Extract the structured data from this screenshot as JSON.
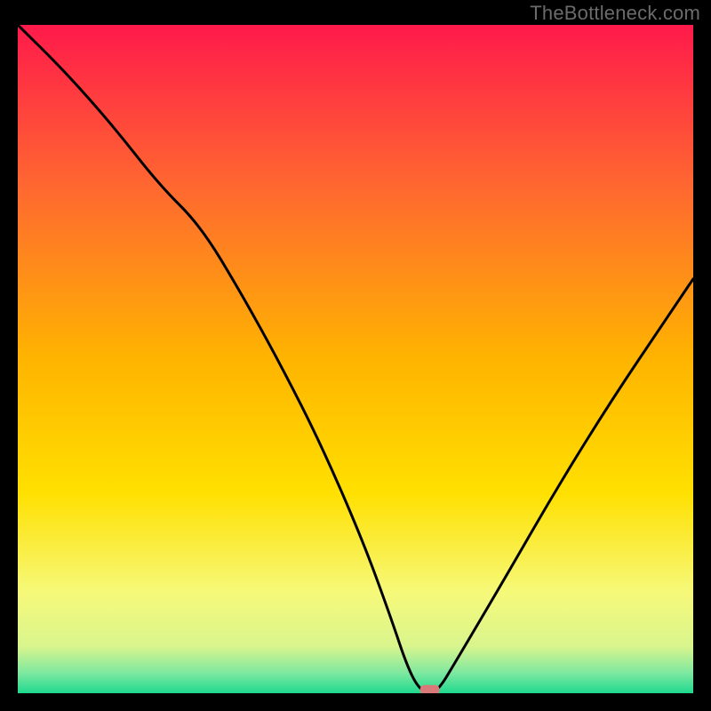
{
  "brand": {
    "watermark": "TheBottleneck.com"
  },
  "chart_data": {
    "type": "line",
    "title": "",
    "xlabel": "",
    "ylabel": "",
    "xlim": [
      0,
      100
    ],
    "ylim": [
      0,
      100
    ],
    "grid": false,
    "legend": false,
    "background_gradient": {
      "stops": [
        {
          "offset": 0.0,
          "color": "#ff1a4b"
        },
        {
          "offset": 0.25,
          "color": "#ff6a2f"
        },
        {
          "offset": 0.5,
          "color": "#ffb400"
        },
        {
          "offset": 0.7,
          "color": "#ffe000"
        },
        {
          "offset": 0.85,
          "color": "#f6f97a"
        },
        {
          "offset": 0.93,
          "color": "#d9f58d"
        },
        {
          "offset": 0.97,
          "color": "#7de8a0"
        },
        {
          "offset": 1.0,
          "color": "#1fd98e"
        }
      ]
    },
    "series": [
      {
        "name": "bottleneck-curve",
        "x": [
          0,
          7,
          14,
          21,
          27,
          33,
          39,
          45,
          51,
          55,
          58,
          60,
          62,
          65,
          72,
          80,
          88,
          96,
          100
        ],
        "y": [
          100,
          93,
          85,
          76,
          70,
          60,
          49,
          37,
          23,
          12,
          3,
          0,
          0,
          5,
          17,
          31,
          44,
          56,
          62
        ]
      }
    ],
    "markers": [
      {
        "name": "optimal-marker",
        "x": 61,
        "y": 0.5,
        "color": "#d97a7a"
      }
    ]
  },
  "colors": {
    "frame_bg": "#000000",
    "curve": "#000000",
    "marker": "#d97a7a",
    "watermark": "#6b6b6b"
  }
}
